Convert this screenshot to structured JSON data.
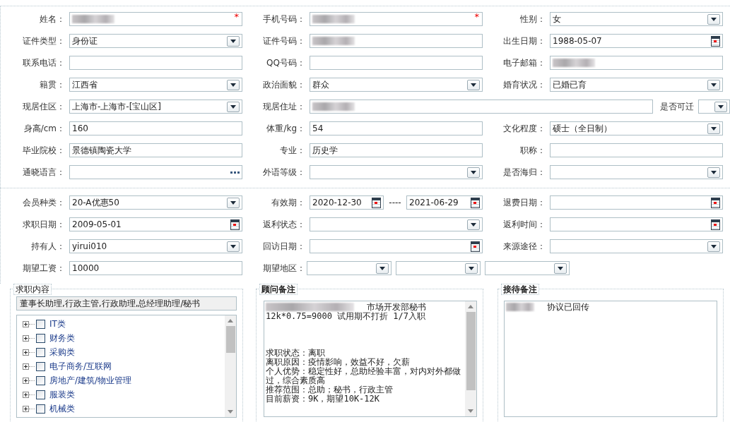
{
  "personal_rows": [
    [
      {
        "label": "姓名：",
        "kind": "text",
        "redacted": true,
        "required_mark": "*"
      },
      {
        "label": "手机号码：",
        "kind": "text",
        "redacted": true,
        "required_mark": "*"
      },
      {
        "label": "性别：",
        "kind": "select",
        "value": "女"
      }
    ],
    [
      {
        "label": "证件类型：",
        "kind": "select",
        "value": "身份证"
      },
      {
        "label": "证件号码：",
        "kind": "text",
        "redacted": true
      },
      {
        "label": "出生日期：",
        "kind": "date",
        "value": "1988-05-07"
      }
    ],
    [
      {
        "label": "联系电话：",
        "kind": "text"
      },
      {
        "label": "QQ号码：",
        "kind": "text"
      },
      {
        "label": "电子邮箱：",
        "kind": "text",
        "redacted": true
      }
    ],
    [
      {
        "label": "籍贯：",
        "kind": "select",
        "value": "江西省"
      },
      {
        "label": "政治面貌：",
        "kind": "select",
        "value": "群众"
      },
      {
        "label": "婚育状况：",
        "kind": "select",
        "value": "已婚已育"
      }
    ],
    [
      {
        "label": "现居住区：",
        "kind": "select",
        "value": "上海市-上海市-[宝山区]"
      },
      {
        "label": "现居住址：",
        "kind": "wide_text",
        "redacted": true
      },
      {
        "label": "是否可迁",
        "kind": "select_small"
      }
    ],
    [
      {
        "label": "身高/cm：",
        "kind": "text",
        "value": "160"
      },
      {
        "label": "体重/kg：",
        "kind": "text",
        "value": "54"
      },
      {
        "label": "文化程度：",
        "kind": "select",
        "value": "硕士（全日制）"
      }
    ],
    [
      {
        "label": "毕业院校：",
        "kind": "text",
        "value": "景德镇陶瓷大学"
      },
      {
        "label": "专业：",
        "kind": "text",
        "value": "历史学"
      },
      {
        "label": "职称：",
        "kind": "text"
      }
    ],
    [
      {
        "label": "通晓语言：",
        "kind": "lookup"
      },
      {
        "label": "外语等级：",
        "kind": "select"
      },
      {
        "label": "是否海归：",
        "kind": "select"
      }
    ]
  ],
  "membership_rows": [
    [
      {
        "label": "会员种类：",
        "kind": "select",
        "value": "20-A优惠50"
      },
      {
        "label": "有效期：",
        "kind": "date_range",
        "values": [
          "2020-12-30",
          "2021-06-29"
        ],
        "separator": "----"
      },
      {
        "label": "退费日期：",
        "kind": "date"
      }
    ],
    [
      {
        "label": "求职日期：",
        "kind": "date",
        "value": "2009-05-01"
      },
      {
        "label": "返利状态：",
        "kind": "select"
      },
      {
        "label": "返利时间：",
        "kind": "date"
      }
    ],
    [
      {
        "label": "持有人：",
        "kind": "select",
        "value": "yirui010"
      },
      {
        "label": "回访日期：",
        "kind": "date"
      },
      {
        "label": "来源途径：",
        "kind": "select"
      }
    ],
    [
      {
        "label": "期望工资：",
        "kind": "text",
        "value": "10000"
      },
      {
        "label": "期望地区：",
        "kind": "select_triple"
      }
    ]
  ],
  "job_panel": {
    "title": "求职内容",
    "summary": "董事长助理,行政主管,行政助理,总经理助理/秘书",
    "categories": [
      {
        "label": "IT类",
        "checked": false,
        "expanded": false
      },
      {
        "label": "财务类",
        "checked": false,
        "expanded": false
      },
      {
        "label": "采购类",
        "checked": false,
        "expanded": false
      },
      {
        "label": "电子商务/互联网",
        "checked": false,
        "expanded": false
      },
      {
        "label": "房地产/建筑/物业管理",
        "checked": false,
        "expanded": false
      },
      {
        "label": "服装类",
        "checked": false,
        "expanded": false
      },
      {
        "label": "机械类",
        "checked": false,
        "expanded": false
      }
    ]
  },
  "consultant_panel": {
    "title": "顾问备注",
    "lines": [
      {
        "text": "市场开发部秘书",
        "redacted": true
      },
      {
        "text": "12k*0.75=9000  试用期不打折    1/7入职"
      },
      {
        "text": "求职状态：离职",
        "space_before": true
      },
      {
        "text": "离职原因：疫情影响，效益不好，欠薪"
      },
      {
        "text": "个人优势：稳定性好，总助经验丰富，对内对外都做过，综合素质高"
      },
      {
        "text": "推荐范围：总助；秘书，行政主管"
      },
      {
        "text": "目前薪资：9K，期望10K-12K"
      }
    ]
  },
  "reception_panel": {
    "title": "接待备注",
    "lines": [
      {
        "text": "协议已回传",
        "redacted": true
      }
    ]
  }
}
